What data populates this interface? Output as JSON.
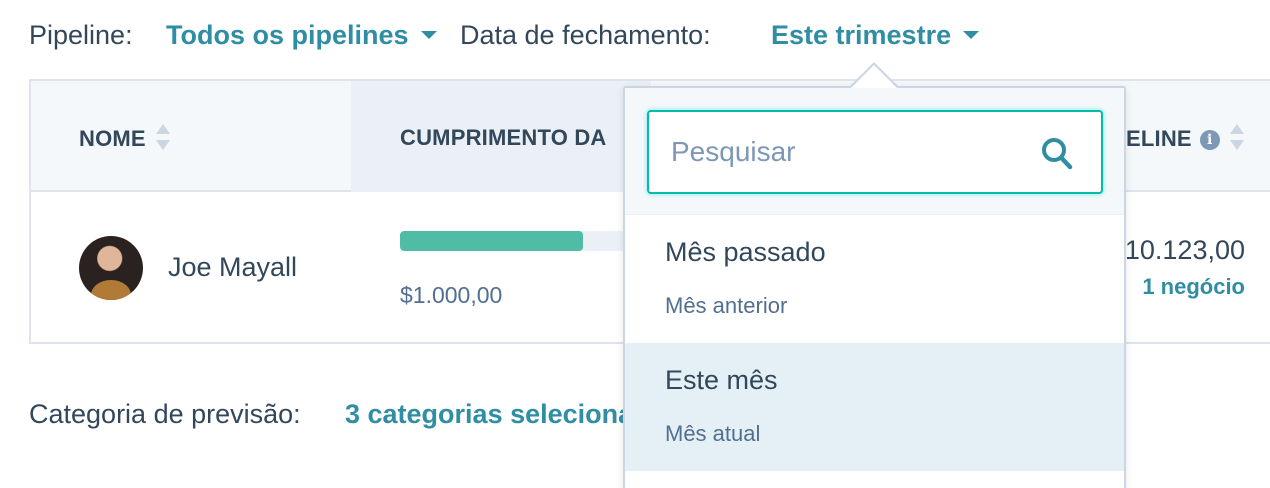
{
  "filters": {
    "pipeline_label": "Pipeline:",
    "pipeline_value": "Todos os pipelines",
    "close_date_label": "Data de fechamento:",
    "close_date_value": "Este trimestre"
  },
  "table": {
    "columns": {
      "name": "NOME",
      "fulfillment": "CUMPRIMENTO DA",
      "pipeline": "ELINE"
    },
    "row": {
      "name": "Joe Mayall",
      "progress_fraction": 0.61,
      "progress_amount": "$1.000,00",
      "pipeline_amount": "10.123,00",
      "pipeline_deals": "1 negócio"
    }
  },
  "forecast": {
    "label": "Categoria de previsão:",
    "value": "3 categorias seleciona"
  },
  "dropdown": {
    "search_placeholder": "Pesquisar",
    "options": [
      {
        "title": "Mês passado",
        "subtitle": "Mês anterior"
      },
      {
        "title": "Este mês",
        "subtitle": "Mês atual"
      }
    ]
  },
  "icons": {
    "search": "search-icon",
    "info": "info-icon",
    "sort": "sort-icon",
    "caret": "caret-down-icon"
  },
  "colors": {
    "link": "#2f8ea3",
    "progress": "#51bca6",
    "focus": "#00bda5",
    "hover_row": "#e5f0f6"
  }
}
